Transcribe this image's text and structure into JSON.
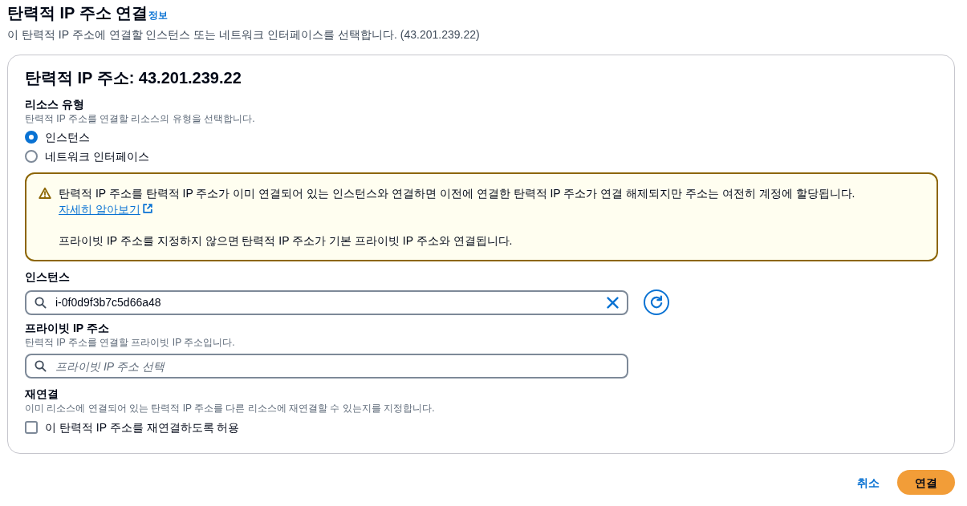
{
  "page": {
    "title": "탄력적 IP 주소 연결",
    "info_link": "정보",
    "description": "이 탄력적 IP 주소에 연결할 인스턴스 또는 네트워크 인터페이스를 선택합니다. (43.201.239.22)"
  },
  "panel": {
    "title": "탄력적 IP 주소: 43.201.239.22",
    "resource_type": {
      "label": "리소스 유형",
      "description": "탄력적 IP 주소를 연결할 리소스의 유형을 선택합니다.",
      "options": [
        {
          "label": "인스턴스",
          "selected": true
        },
        {
          "label": "네트워크 인터페이스",
          "selected": false
        }
      ]
    },
    "alert": {
      "kind": "warning",
      "message": "탄력적 IP 주소를 탄력적 IP 주소가 이미 연결되어 있는 인스턴스와 연결하면 이전에 연결한 탄력적 IP 주소가 연결 해제되지만 주소는 여전히 계정에 할당됩니다.",
      "link": "자세히 알아보기",
      "note": "프라이빗 IP 주소를 지정하지 않으면 탄력적 IP 주소가 기본 프라이빗 IP 주소와 연결됩니다."
    },
    "instance": {
      "label": "인스턴스",
      "value": "i-0f0d9f3b7c5d66a48"
    },
    "private_ip": {
      "label": "프라이빗 IP 주소",
      "description": "탄력적 IP 주소를 연결할 프라이빗 IP 주소입니다.",
      "placeholder": "프라이빗 IP 주소 선택"
    },
    "reassociation": {
      "label": "재연결",
      "description": "이미 리소스에 연결되어 있는 탄력적 IP 주소를 다른 리소스에 재연결할 수 있는지를 지정합니다.",
      "checkbox": {
        "label": "이 탄력적 IP 주소를 재연결하도록 허용",
        "checked": false
      }
    }
  },
  "buttons": [
    {
      "label": "취소",
      "kind": "link"
    },
    {
      "label": "연결",
      "kind": "primary"
    }
  ]
}
